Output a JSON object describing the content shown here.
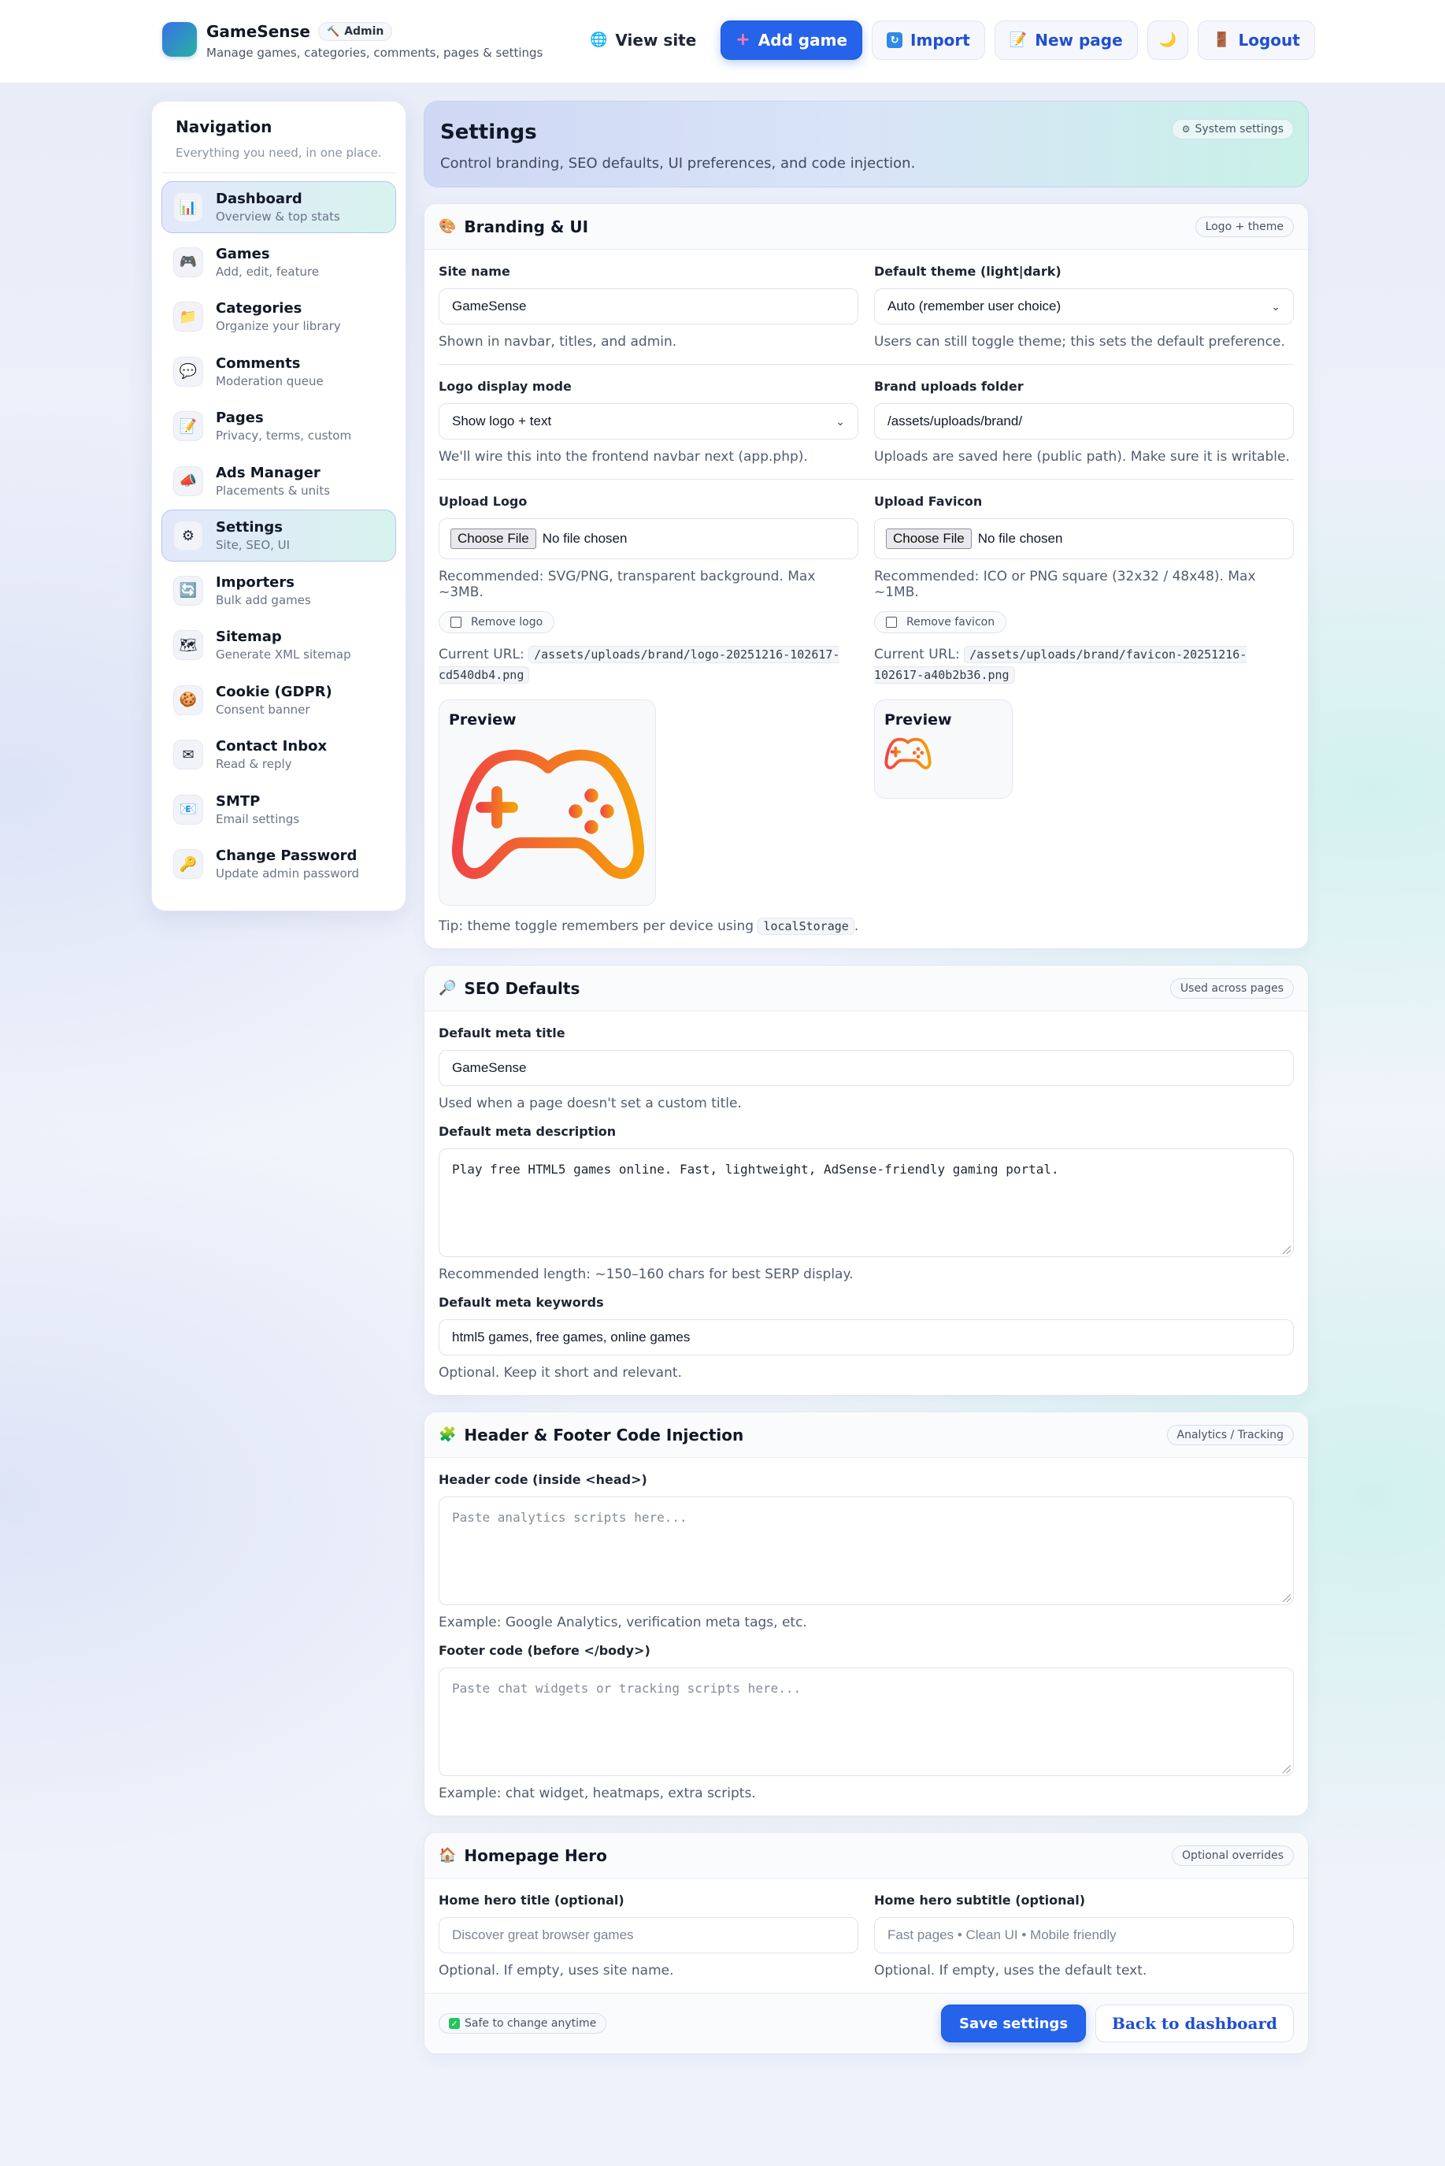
{
  "topbar": {
    "brand_name": "GameSense",
    "admin_badge": "Admin",
    "subtitle": "Manage games, categories, comments, pages & settings",
    "buttons": {
      "view_site": "View site",
      "add_game": "Add game",
      "import": "Import",
      "new_page": "New page",
      "logout": "Logout"
    }
  },
  "sidebar": {
    "title": "Navigation",
    "subtitle": "Everything you need, in one place.",
    "items": [
      {
        "label": "Dashboard",
        "desc": "Overview & top stats",
        "icon": "📊"
      },
      {
        "label": "Games",
        "desc": "Add, edit, feature",
        "icon": "🎮"
      },
      {
        "label": "Categories",
        "desc": "Organize your library",
        "icon": "📁"
      },
      {
        "label": "Comments",
        "desc": "Moderation queue",
        "icon": "💬"
      },
      {
        "label": "Pages",
        "desc": "Privacy, terms, custom",
        "icon": "📝"
      },
      {
        "label": "Ads Manager",
        "desc": "Placements & units",
        "icon": "📣"
      },
      {
        "label": "Settings",
        "desc": "Site, SEO, UI",
        "icon": "⚙"
      },
      {
        "label": "Importers",
        "desc": "Bulk add games",
        "icon": "🔄"
      },
      {
        "label": "Sitemap",
        "desc": "Generate XML sitemap",
        "icon": "🗺"
      },
      {
        "label": "Cookie (GDPR)",
        "desc": "Consent banner",
        "icon": "🍪"
      },
      {
        "label": "Contact Inbox",
        "desc": "Read & reply",
        "icon": "✉"
      },
      {
        "label": "SMTP",
        "desc": "Email settings",
        "icon": "📧"
      },
      {
        "label": "Change Password",
        "desc": "Update admin password",
        "icon": "🔑"
      }
    ]
  },
  "hero": {
    "title": "Settings",
    "subtitle": "Control branding, SEO defaults, UI preferences, and code injection.",
    "pill": "System settings"
  },
  "branding": {
    "title": "Branding & UI",
    "pill": "Logo + theme",
    "site_name_label": "Site name",
    "site_name_value": "GameSense",
    "site_name_help": "Shown in navbar, titles, and admin.",
    "theme_label": "Default theme (light|dark)",
    "theme_value": "Auto (remember user choice)",
    "theme_help": "Users can still toggle theme; this sets the default preference.",
    "logo_mode_label": "Logo display mode",
    "logo_mode_value": "Show logo + text",
    "logo_mode_help": "We'll wire this into the frontend navbar next (app.php).",
    "folder_label": "Brand uploads folder",
    "folder_value": "/assets/uploads/brand/",
    "folder_help": "Uploads are saved here (public path). Make sure it is writable.",
    "upload_logo_label": "Upload Logo",
    "upload_favicon_label": "Upload Favicon",
    "choose_file": "Choose File",
    "no_file": "No file chosen",
    "logo_help": "Recommended: SVG/PNG, transparent background. Max ~3MB.",
    "favicon_help": "Recommended: ICO or PNG square (32x32 / 48x48). Max ~1MB.",
    "remove_logo": "Remove logo",
    "remove_favicon": "Remove favicon",
    "current_url_label": "Current URL:",
    "logo_url": "/assets/uploads/brand/logo-20251216-102617-cd540db4.png",
    "favicon_url": "/assets/uploads/brand/favicon-20251216-102617-a40b2b36.png",
    "preview_label": "Preview",
    "tip_prefix": "Tip: theme toggle remembers per device using",
    "tip_code": "localStorage",
    "tip_suffix": "."
  },
  "seo": {
    "title": "SEO Defaults",
    "pill": "Used across pages",
    "meta_title_label": "Default meta title",
    "meta_title_value": "GameSense",
    "meta_title_help": "Used when a page doesn't set a custom title.",
    "meta_desc_label": "Default meta description",
    "meta_desc_value": "Play free HTML5 games online. Fast, lightweight, AdSense-friendly gaming portal.",
    "meta_desc_help": "Recommended length: ~150–160 chars for best SERP display.",
    "meta_kw_label": "Default meta keywords",
    "meta_kw_value": "html5 games, free games, online games",
    "meta_kw_help": "Optional. Keep it short and relevant."
  },
  "injection": {
    "title": "Header & Footer Code Injection",
    "pill": "Analytics / Tracking",
    "header_label": "Header code (inside <head>)",
    "header_placeholder": "Paste analytics scripts here...",
    "header_help": "Example: Google Analytics, verification meta tags, etc.",
    "footer_label": "Footer code (before </body>)",
    "footer_placeholder": "Paste chat widgets or tracking scripts here...",
    "footer_help": "Example: chat widget, heatmaps, extra scripts."
  },
  "homepage": {
    "title": "Homepage Hero",
    "pill": "Optional overrides",
    "hero_title_label": "Home hero title (optional)",
    "hero_title_placeholder": "Discover great browser games",
    "hero_title_help": "Optional. If empty, uses site name.",
    "hero_sub_label": "Home hero subtitle (optional)",
    "hero_sub_placeholder": "Fast pages • Clean UI • Mobile friendly",
    "hero_sub_help": "Optional. If empty, uses the default text."
  },
  "footer": {
    "safe_badge": "Safe to change anytime",
    "save_button": "Save settings",
    "back_button": "Back to dashboard"
  },
  "colors": {
    "accent": "#2563eb",
    "logo_gradient_start": "#ef4444",
    "logo_gradient_end": "#f59e0b"
  }
}
